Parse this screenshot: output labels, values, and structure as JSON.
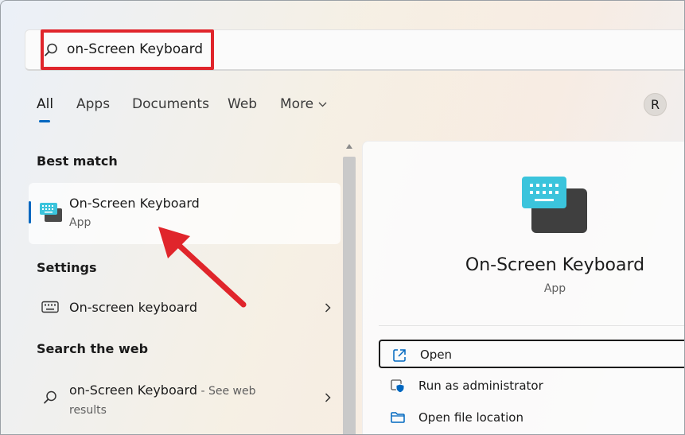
{
  "search": {
    "value": "on-Screen Keyboard"
  },
  "tabs": [
    {
      "label": "All"
    },
    {
      "label": "Apps"
    },
    {
      "label": "Documents"
    },
    {
      "label": "Web"
    },
    {
      "label": "More"
    }
  ],
  "user": {
    "avatar_initial": "R"
  },
  "results": {
    "best_match_header": "Best match",
    "best_match": {
      "title": "On-Screen Keyboard",
      "subtitle": "App",
      "icon": "keyboard-app-icon"
    },
    "settings_header": "Settings",
    "settings_item": {
      "label": "On-screen keyboard",
      "icon": "keyboard-outline-icon"
    },
    "web_header": "Search the web",
    "web_item": {
      "label": "on-Screen Keyboard",
      "suffix": " - See web",
      "suffix_line2": "results",
      "icon": "search-icon"
    }
  },
  "detail": {
    "title": "On-Screen Keyboard",
    "subtitle": "App",
    "actions": [
      {
        "label": "Open",
        "icon": "open-external-icon"
      },
      {
        "label": "Run as administrator",
        "icon": "shield-admin-icon"
      },
      {
        "label": "Open file location",
        "icon": "folder-icon"
      }
    ]
  },
  "colors": {
    "accent": "#0067c0",
    "annotation": "#e0252b"
  }
}
